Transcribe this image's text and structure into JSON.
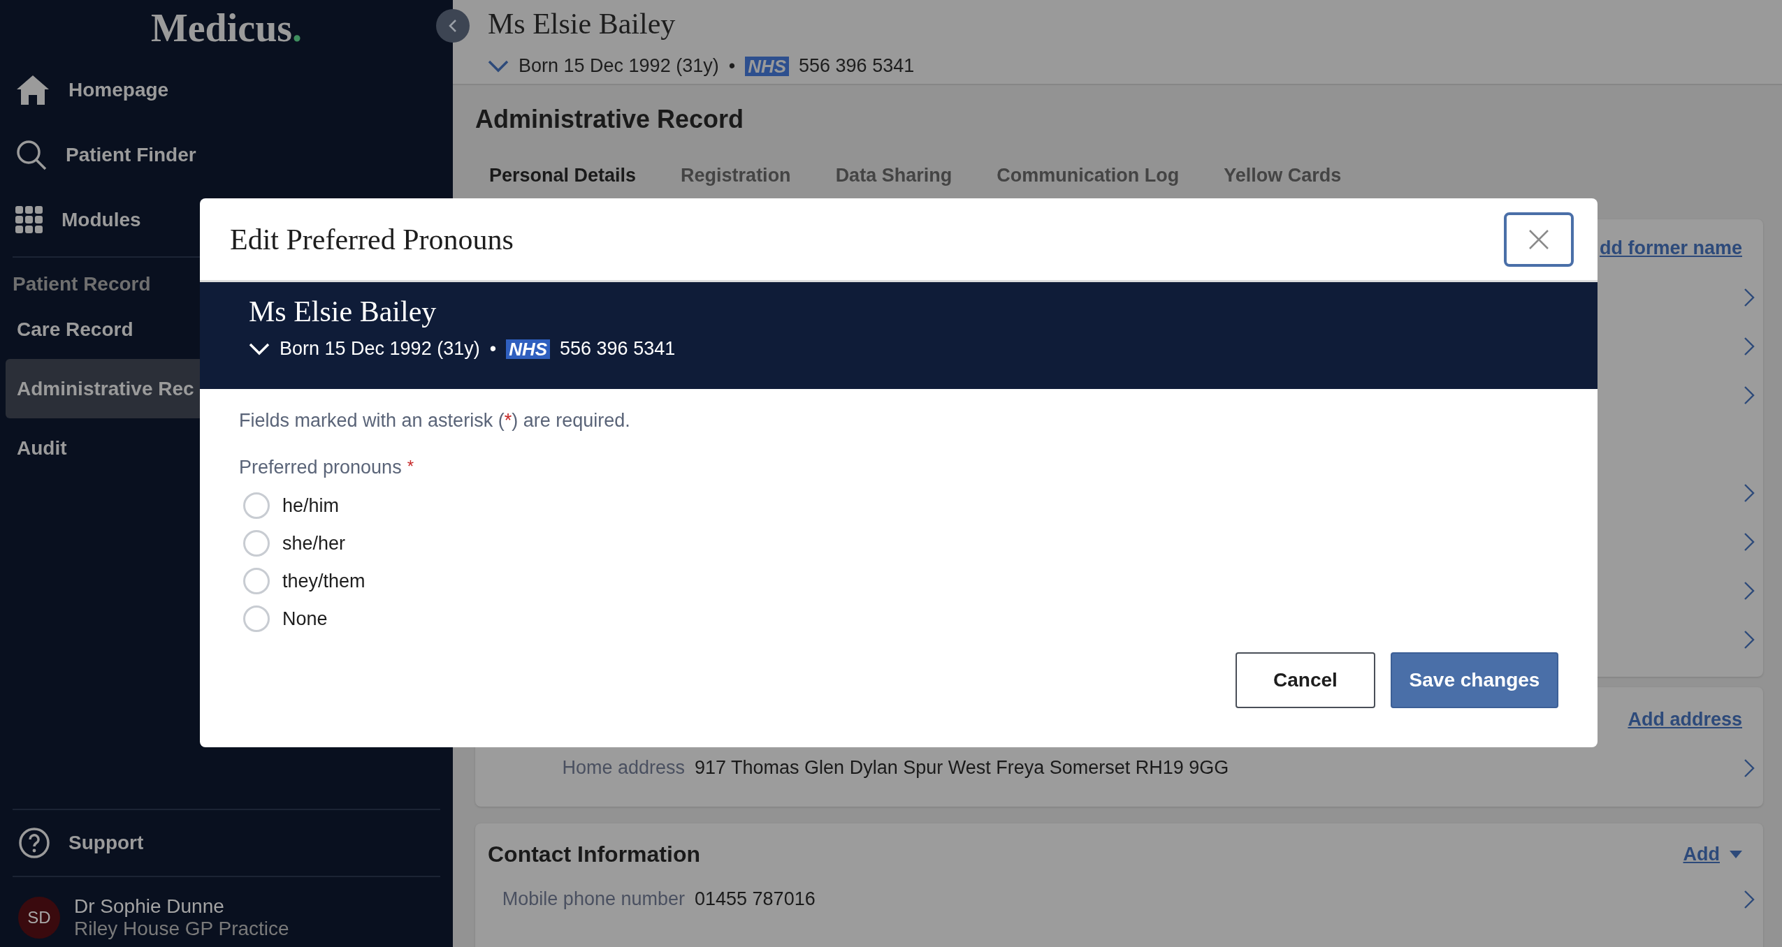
{
  "sidebar": {
    "logo": {
      "name": "Medicus",
      "dot": "."
    },
    "nav": [
      {
        "kind": "home",
        "label": "Homepage"
      },
      {
        "kind": "search",
        "label": "Patient Finder"
      },
      {
        "kind": "grid",
        "label": "Modules"
      }
    ],
    "section_heading": "Patient Record",
    "items": [
      {
        "label": "Care Record",
        "selected": false
      },
      {
        "label": "Administrative Rec",
        "selected": true
      },
      {
        "label": "Audit",
        "selected": false
      }
    ],
    "support": "Support",
    "user": {
      "initials": "SD",
      "name": "Dr Sophie Dunne",
      "practice": "Riley House GP Practice"
    }
  },
  "patient_header": {
    "name": "Ms Elsie Bailey",
    "born": "Born 15 Dec 1992 (31y)",
    "separator": "•",
    "nhs_label": "NHS",
    "nhs_number": "556 396 5341"
  },
  "page": {
    "title": "Administrative Record",
    "tabs": [
      {
        "label": "Personal Details",
        "selected": true
      },
      {
        "label": "Registration",
        "selected": false
      },
      {
        "label": "Data Sharing",
        "selected": false
      },
      {
        "label": "Communication Log",
        "selected": false
      },
      {
        "label": "Yellow Cards",
        "selected": false
      }
    ],
    "cards": [
      {
        "kind": "covered",
        "link": "dd former name"
      },
      {
        "kind": "address",
        "link": "Add address",
        "rows": [
          {
            "label": "Home address",
            "value": "917 Thomas Glen Dylan Spur West Freya Somerset RH19 9GG"
          }
        ]
      },
      {
        "kind": "contact",
        "title": "Contact Information",
        "link": "Add",
        "rows": [
          {
            "label": "Mobile phone number",
            "value": "01455 787016"
          }
        ]
      }
    ]
  },
  "modal": {
    "title": "Edit Preferred Pronouns",
    "patient": {
      "name": "Ms Elsie Bailey",
      "born": "Born 15 Dec 1992 (31y)",
      "separator": "•",
      "nhs_label": "NHS",
      "nhs_number": "556 396 5341"
    },
    "hint": {
      "before": "Fields marked with an asterisk (",
      "mark": "*",
      "after": ") are required."
    },
    "field_label": "Preferred pronouns",
    "required_mark": "*",
    "options": [
      {
        "label": "he/him",
        "selected": false
      },
      {
        "label": "she/her",
        "selected": false
      },
      {
        "label": "they/them",
        "selected": false
      },
      {
        "label": "None",
        "selected": false
      }
    ],
    "buttons": [
      {
        "kind": "secondary",
        "label": "Cancel"
      },
      {
        "kind": "primary",
        "label": "Save changes"
      }
    ]
  }
}
